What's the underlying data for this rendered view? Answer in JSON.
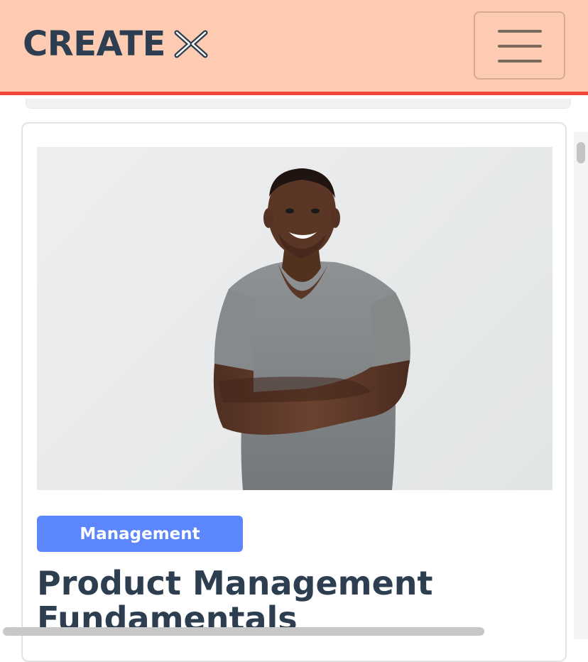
{
  "header": {
    "logo_text": "CREATE",
    "logo_mark_icon": "create-x-mark-icon",
    "menu_icon": "hamburger-icon",
    "background_color": "#fccbb1",
    "accent_border_color": "#f2453a"
  },
  "course": {
    "image_subject": "smiling-man-arms-crossed-photo",
    "category": "Management",
    "category_color": "#5c86fb",
    "title": "Product Management Fundamentals"
  }
}
